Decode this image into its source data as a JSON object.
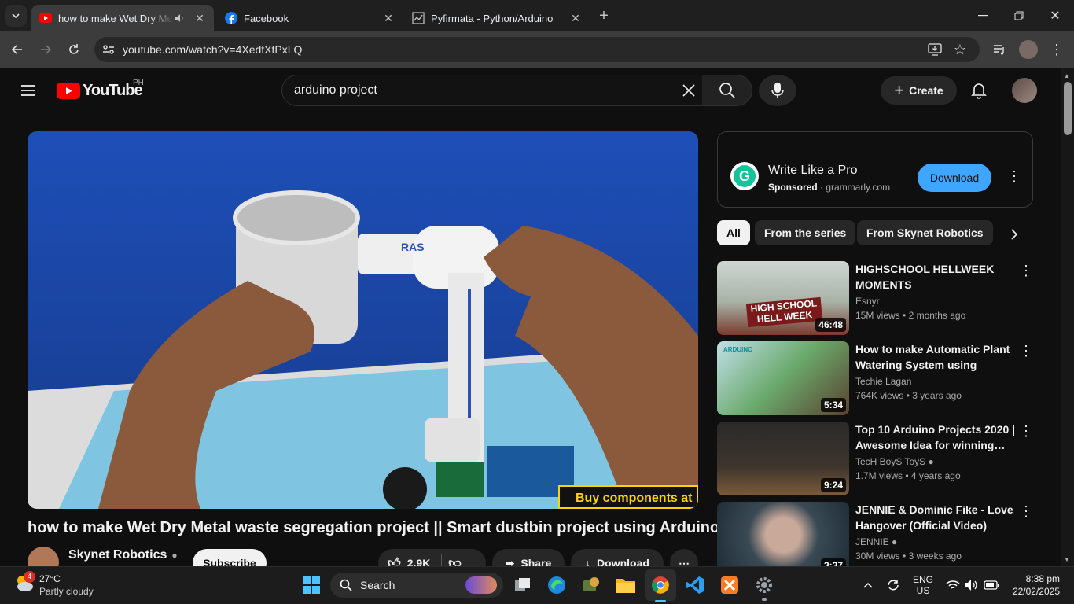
{
  "browser": {
    "tabs": [
      {
        "title": "how to make Wet Dry Meta",
        "favicon": "youtube-icon",
        "audio": "speaker-icon"
      },
      {
        "title": "Facebook",
        "favicon": "facebook-icon"
      },
      {
        "title": "Pyfirmata - Python/Arduino",
        "favicon": "chart-line-icon"
      }
    ],
    "url": "youtube.com/watch?v=4XedfXtPxLQ"
  },
  "youtube": {
    "logo_text": "YouTube",
    "region": "PH",
    "search_value": "arduino project",
    "create_label": "Create"
  },
  "video": {
    "overlay_text": "Buy components at",
    "pipe_text": "RAS",
    "title": "how to make Wet Dry Metal waste segregation project || Smart dustbin project using Arduino",
    "channel": "Skynet Robotics",
    "subscribe": "Subscribe",
    "likes": "2.9K",
    "share": "Share",
    "download": "Download"
  },
  "ad": {
    "title": "Write Like a Pro",
    "sponsored": "Sponsored",
    "domain": "grammarly.com",
    "cta": "Download"
  },
  "chips": [
    "All",
    "From the series",
    "From Skynet Robotics"
  ],
  "recommendations": [
    {
      "title": "HIGHSCHOOL HELLWEEK MOMENTS",
      "channel": "Esnyr",
      "verified": false,
      "views": "15M views",
      "age": "2 months ago",
      "duration": "46:48",
      "thumb_text": "HIGH SCHOOL HELL WEEK"
    },
    {
      "title": "How to make Automatic Plant Watering System using Arduin…",
      "channel": "Techie Lagan",
      "verified": false,
      "views": "764K views",
      "age": "3 years ago",
      "duration": "5:34",
      "thumb_text": "ARDUINO"
    },
    {
      "title": "Top 10 Arduino Projects 2020 | Awesome Idea for winning…",
      "channel": "TecH BoyS ToyS",
      "verified": true,
      "views": "1.7M views",
      "age": "4 years ago",
      "duration": "9:24"
    },
    {
      "title": "JENNIE & Dominic Fike - Love Hangover (Official Video)",
      "channel": "JENNIE",
      "verified": true,
      "views": "30M views",
      "age": "3 weeks ago",
      "duration": "3:37"
    }
  ],
  "taskbar": {
    "weather_temp": "27°C",
    "weather_desc": "Partly cloudy",
    "weather_badge": "4",
    "search_label": "Search",
    "lang": "ENG",
    "region": "US",
    "time": "8:38 pm",
    "date": "22/02/2025"
  }
}
